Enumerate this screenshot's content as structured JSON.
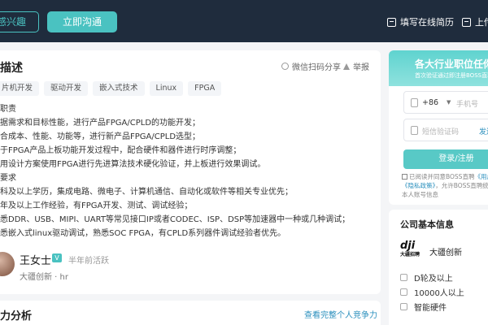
{
  "header": {
    "interest_button": "感兴趣",
    "chat_button": "立即沟通",
    "resume_link": "填写在线简历",
    "upload_link": "上传"
  },
  "job": {
    "section_title": "描述",
    "share_label": "微信扫码分享",
    "report_label": "举报",
    "tags": [
      "片机开发",
      "驱动开发",
      "嵌入式技术",
      "Linux",
      "FPGA"
    ],
    "description_lines": [
      "职责",
      "据需求和目标性能，进行产品FPGA/CPLD的功能开发；",
      "合成本、性能、功能等，进行新产品FPGA/CPLD选型；",
      "于FPGA产品上板功能开发过程中，配合硬件和器件进行时序调整；",
      "用设计方案使用FPGA进行先进算法技术硬化验证，并上板进行效果调试。",
      "要求",
      "科及以上学历，集成电路、微电子、计算机通信、自动化或软件等相关专业优先；",
      "年及以上工作经验，有FPGA开发、测试、调试经验；",
      "悉DDR、USB、MIPI、UART等常见接口IP或者CODEC、ISP、DSP等加速器中一种或几种调试；",
      "悉嵌入式linux驱动调试，熟悉SOC FPGA，有CPLD系列器件调试经验者优先。"
    ]
  },
  "recruiter": {
    "name": "王女士",
    "verified_badge": "V",
    "active_status": "半年前活跃",
    "company_role": "大疆创新 · hr"
  },
  "competitiveness": {
    "title": "力分析",
    "link": "查看完整个人竞争力"
  },
  "login": {
    "title": "各大行业职位任你选",
    "subtitle": "首次验证通过即注册BOSS直聘账号",
    "country_code": "+86",
    "phone_placeholder": "手机号",
    "code_placeholder": "短信验证码",
    "send_code": "发送验证",
    "submit": "登录/注册",
    "agree_text_1": "已阅读并同意BOSS直聘",
    "agree_link_1": "《用户",
    "agree_link_2": "《隐私政策》",
    "agree_text_2": "，允许BOSS直聘统一",
    "agree_text_3": "本人账号信息"
  },
  "company": {
    "section_title": "公司基本信息",
    "logo_text": "dji",
    "logo_sub": "大疆招聘",
    "name": "大疆创新",
    "funding": "D轮及以上",
    "size": "10000人以上",
    "industry": "智能硬件"
  }
}
